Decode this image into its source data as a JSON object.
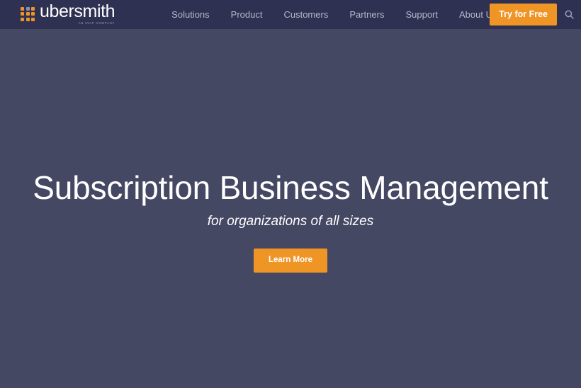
{
  "header": {
    "logo": {
      "wordmark": "ubersmith",
      "tagline": "AN INAP COMPANY",
      "dot_color": "#ef9526",
      "dot_alt_color": "#8b8fb5",
      "dot_grid": [
        "orange",
        "blue",
        "orange",
        "orange",
        "orange",
        "orange",
        "orange",
        "orange",
        "orange"
      ]
    },
    "nav": [
      {
        "label": "Solutions"
      },
      {
        "label": "Product"
      },
      {
        "label": "Customers"
      },
      {
        "label": "Partners"
      },
      {
        "label": "Support"
      },
      {
        "label": "About Us"
      }
    ],
    "cta": {
      "label": "Try for Free",
      "color": "#ef9526"
    },
    "search": {
      "icon": "search-icon"
    },
    "background_color": "#2e3152"
  },
  "hero": {
    "title": "Subscription Business Management",
    "subtitle": "for organizations of all sizes",
    "cta": {
      "label": "Learn More",
      "color": "#ef9526"
    },
    "background_color": "#454863",
    "text_color": "#ffffff"
  }
}
